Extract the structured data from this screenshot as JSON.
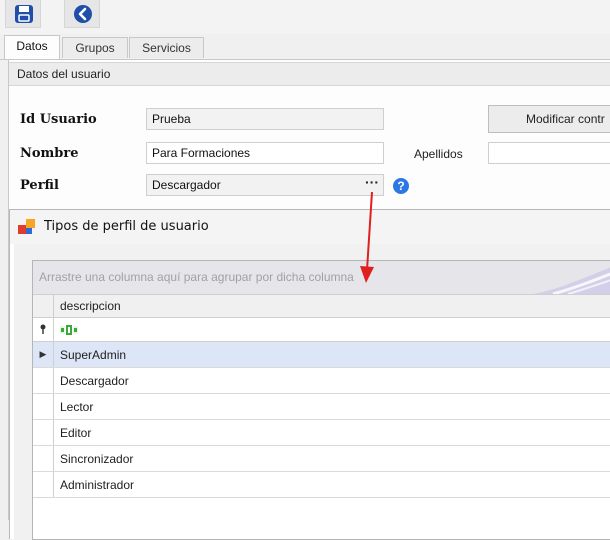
{
  "toolbar": {
    "save_icon": "floppy-disk-icon",
    "back_icon": "back-circle-icon",
    "accent": "#1f5fbf"
  },
  "tabs": [
    {
      "label": "Datos",
      "active": true
    },
    {
      "label": "Grupos",
      "active": false
    },
    {
      "label": "Servicios",
      "active": false
    }
  ],
  "section": {
    "title": "Datos del usuario"
  },
  "form": {
    "id_label": "Id Usuario",
    "id_value": "Prueba",
    "nombre_label": "Nombre",
    "nombre_value": "Para Formaciones",
    "apellidos_label": "Apellidos",
    "apellidos_value": "",
    "perfil_label": "Perfil",
    "perfil_value": "Descargador",
    "ellipsis": "···",
    "help": "?",
    "modify_button": "Modificar contr"
  },
  "popup": {
    "title": "Tipos de perfil de usuario",
    "group_hint": "Arrastre una columna aquí para agrupar por dicha columna",
    "column": "descripcion",
    "rows": [
      "SuperAdmin",
      "Descargador",
      "Lector",
      "Editor",
      "Sincronizador",
      "Administrador"
    ],
    "selected_index": 0,
    "selected_color": "#dde6f7"
  },
  "annotation": {
    "arrow_color": "#e02020"
  }
}
